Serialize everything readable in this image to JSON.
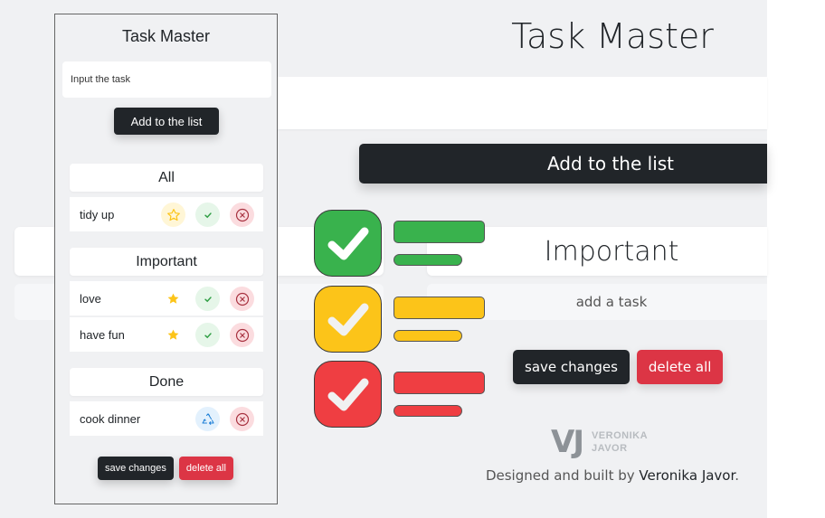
{
  "background_page": {
    "title": "Task Master",
    "input_value": "",
    "add_button": "Add to the list",
    "section_title": "Important",
    "empty_task_text": "add a task",
    "save_button": "save changes",
    "delete_button": "delete all",
    "logo": {
      "mark": "VJ",
      "line1": "VERONIKA",
      "line2": "JAVOR"
    },
    "credits_prefix": "Designed and built by ",
    "credits_author": "Veronika Javor",
    "credits_suffix": "."
  },
  "illustration": {
    "rows": [
      {
        "color": "#39b24d",
        "icon": "check-icon"
      },
      {
        "color": "#fcc419",
        "icon": "check-icon"
      },
      {
        "color": "#ef3e42",
        "icon": "check-icon"
      }
    ]
  },
  "phone": {
    "title": "Task Master",
    "input_value": "Input the task",
    "add_button": "Add to the list",
    "sections": [
      {
        "title": "All",
        "items": [
          {
            "label": "tidy up",
            "icons": [
              "star-outline-icon",
              "check-icon",
              "close-circle-icon"
            ]
          }
        ]
      },
      {
        "title": "Important",
        "items": [
          {
            "label": "love",
            "icons": [
              "star-filled-icon",
              "check-icon",
              "close-circle-icon"
            ]
          },
          {
            "label": "have fun",
            "icons": [
              "star-filled-icon",
              "check-icon",
              "close-circle-icon"
            ]
          }
        ]
      },
      {
        "title": "Done",
        "items": [
          {
            "label": "cook dinner",
            "icons": [
              "recycle-icon",
              "close-circle-icon"
            ]
          }
        ]
      }
    ],
    "save_button": "save changes",
    "delete_button": "delete all"
  },
  "colors": {
    "background": "#f0f1f3",
    "dark": "#212529",
    "danger": "#dc3545",
    "star": "#fcc419",
    "success": "#2f9e44",
    "recycle": "#1c7ed6"
  }
}
